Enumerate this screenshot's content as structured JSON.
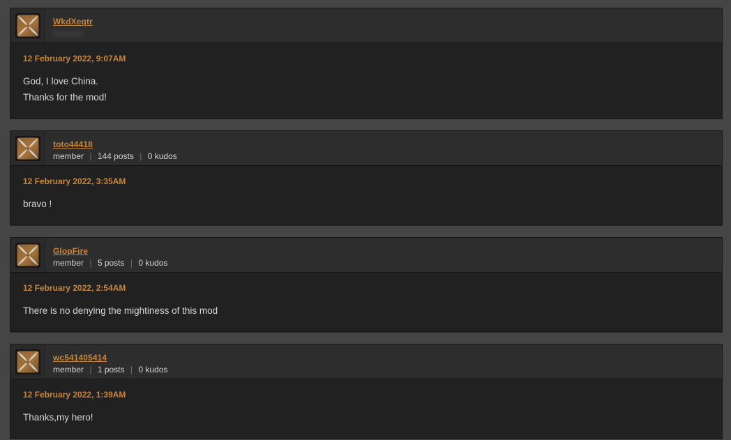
{
  "theme": {
    "page_background": "#454545",
    "card_background": "#212121",
    "header_background": "#2d2d2d",
    "accent": "#c7853a",
    "body_text": "#d7d7d7",
    "meta_text": "#d2d2d2"
  },
  "comments": [
    {
      "avatar_icon": "default-user-avatar-icon",
      "username": "WkdXeqtr",
      "member_label": "member",
      "posts": "",
      "kudos": "",
      "meta_redacted": true,
      "date": "12 February 2022, 9:07AM",
      "text": "God, I love China.\nThanks for the mod!"
    },
    {
      "avatar_icon": "default-user-avatar-icon",
      "username": "toto44418",
      "member_label": "member",
      "posts": "144 posts",
      "kudos": "0 kudos",
      "meta_redacted": false,
      "date": "12 February 2022, 3:35AM",
      "text": "bravo !"
    },
    {
      "avatar_icon": "default-user-avatar-icon",
      "username": "GlopFire",
      "member_label": "member",
      "posts": "5 posts",
      "kudos": "0 kudos",
      "meta_redacted": false,
      "date": "12 February 2022, 2:54AM",
      "text": "There is no denying the mightiness of this mod"
    },
    {
      "avatar_icon": "default-user-avatar-icon",
      "username": "wc541405414",
      "member_label": "member",
      "posts": "1 posts",
      "kudos": "0 kudos",
      "meta_redacted": false,
      "date": "12 February 2022, 1:39AM",
      "text": "Thanks,my hero!"
    }
  ],
  "separator": "|"
}
